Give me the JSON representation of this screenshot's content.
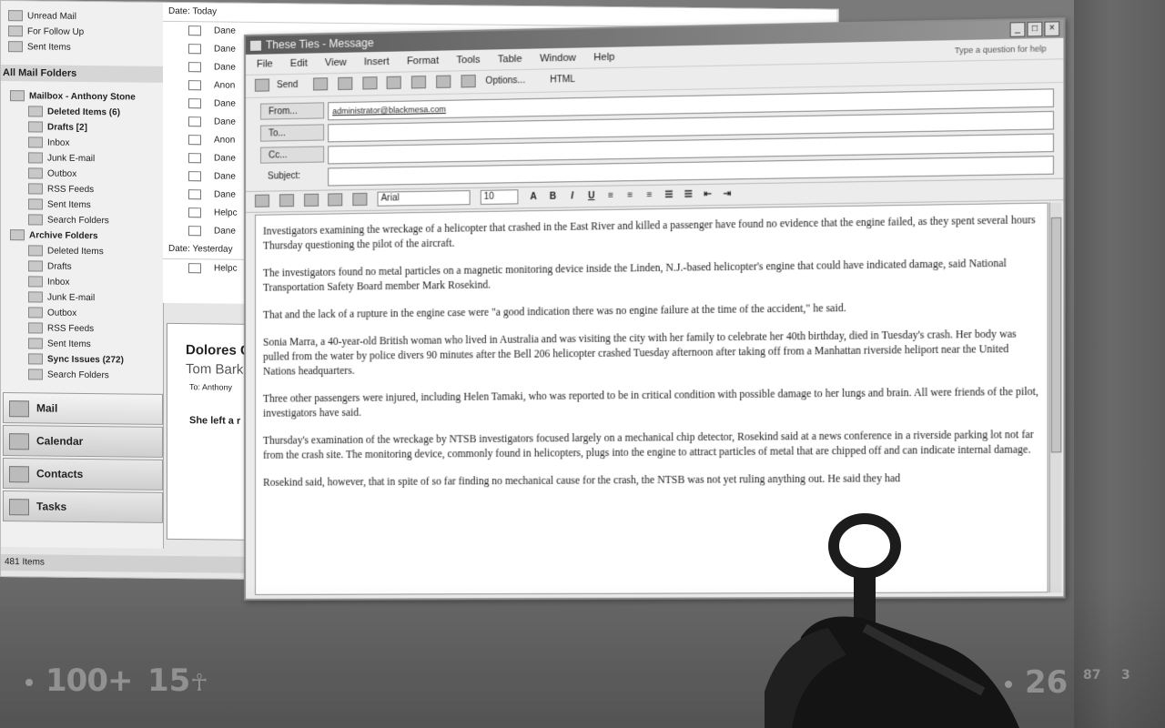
{
  "outlook": {
    "favorites": [
      "Unread Mail",
      "For Follow Up",
      "Sent Items"
    ],
    "all_mail_header": "All Mail Folders",
    "folders": [
      {
        "label": "Mailbox - Anthony Stone",
        "level": 1
      },
      {
        "label": "Deleted Items (6)",
        "level": 2,
        "bold": true
      },
      {
        "label": "Drafts [2]",
        "level": 2,
        "bold": true
      },
      {
        "label": "Inbox",
        "level": 2
      },
      {
        "label": "Junk E-mail",
        "level": 2
      },
      {
        "label": "Outbox",
        "level": 2
      },
      {
        "label": "RSS Feeds",
        "level": 2
      },
      {
        "label": "Sent Items",
        "level": 2
      },
      {
        "label": "Search Folders",
        "level": 2
      },
      {
        "label": "Archive Folders",
        "level": 1
      },
      {
        "label": "Deleted Items",
        "level": 2
      },
      {
        "label": "Drafts",
        "level": 2
      },
      {
        "label": "Inbox",
        "level": 2
      },
      {
        "label": "Junk E-mail",
        "level": 2
      },
      {
        "label": "Outbox",
        "level": 2
      },
      {
        "label": "RSS Feeds",
        "level": 2
      },
      {
        "label": "Sent Items",
        "level": 2
      },
      {
        "label": "Sync Issues (272)",
        "level": 2,
        "bold": true
      },
      {
        "label": "Search Folders",
        "level": 2
      }
    ],
    "nav_buttons": [
      "Mail",
      "Calendar",
      "Contacts",
      "Tasks"
    ],
    "status": "481 Items",
    "list_header_today": "Date: Today",
    "list_header_yesterday": "Date: Yesterday",
    "list_rows": [
      "Dane",
      "Dane",
      "Dane",
      "Anon",
      "Dane",
      "Dane",
      "Anon",
      "Dane",
      "Dane",
      "Dane",
      "Helpc",
      "Dane"
    ],
    "list_rows_yesterday": [
      "Helpc"
    ],
    "reading": {
      "from": "Dolores C",
      "sender": "Tom Bark",
      "to_label": "To:",
      "to": "Anthony",
      "snippet": "She left a r"
    }
  },
  "compose": {
    "title": "These Ties - Message",
    "menu": [
      "File",
      "Edit",
      "View",
      "Insert",
      "Format",
      "Tools",
      "Table",
      "Window",
      "Help"
    ],
    "ask": "Type a question for help",
    "toolbar": {
      "send": "Send",
      "options": "Options...",
      "format": "HTML"
    },
    "fields": {
      "from_label": "From...",
      "from_value": "administrator@blackmesa.com",
      "to_label": "To...",
      "cc_label": "Cc...",
      "subject_label": "Subject:"
    },
    "format_bar": {
      "font": "Arial",
      "size": "10"
    },
    "body": [
      "Investigators examining the wreckage of a helicopter that crashed in the East River and killed a passenger have found no evidence that the engine failed, as they spent several hours Thursday questioning the pilot of the aircraft.",
      "The investigators found no metal particles on a magnetic monitoring device inside the Linden, N.J.-based helicopter's engine that could have indicated damage, said National Transportation Safety Board member Mark Rosekind.",
      "That and the lack of a rupture in the engine case were \"a good indication there was no engine failure at the time of the accident,\" he said.",
      "Sonia Marra, a 40-year-old British woman who lived in Australia and was visiting the city with her family to celebrate her 40th birthday, died in Tuesday's crash. Her body was pulled from the water by police divers 90 minutes after the Bell 206 helicopter crashed Tuesday afternoon after taking off from a Manhattan riverside heliport near the United Nations headquarters.",
      "Three other passengers were injured, including Helen Tamaki, who was reported to be in critical condition with possible damage to her lungs and brain. All were friends of the pilot, investigators have said.",
      "Thursday's examination of the wreckage by NTSB investigators focused largely on a mechanical chip detector, Rosekind said at a news conference in a riverside parking lot not far from the crash site. The monitoring device, commonly found in helicopters, plugs into the engine to attract particles of metal that are chipped off and can indicate internal damage.",
      "Rosekind said, however, that in spite of so far finding no mechanical cause for the crash, the NTSB was not yet ruling anything out. He said they had"
    ]
  },
  "hud": {
    "health": "100",
    "armor": "15",
    "ammo": "26",
    "reserve": "87",
    "grenades": "3",
    "accent": "#bebebe"
  }
}
